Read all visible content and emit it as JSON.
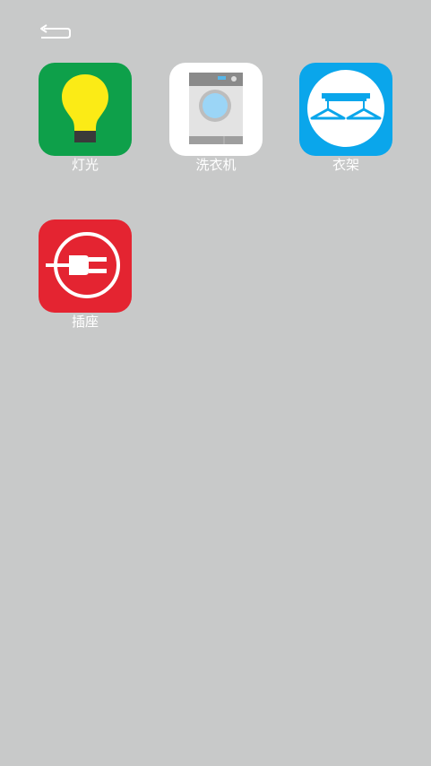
{
  "nav": {
    "back_icon": "back-arrow-icon"
  },
  "devices": [
    {
      "id": "light",
      "label": "灯光",
      "icon": "lightbulb-icon",
      "color": "#0ea04a"
    },
    {
      "id": "washer",
      "label": "洗衣机",
      "icon": "washing-machine-icon",
      "color": "#ffffff"
    },
    {
      "id": "rack",
      "label": "衣架",
      "icon": "clothes-hanger-icon",
      "color": "#0aa6eb"
    },
    {
      "id": "socket",
      "label": "插座",
      "icon": "power-plug-icon",
      "color": "#e42431"
    }
  ]
}
